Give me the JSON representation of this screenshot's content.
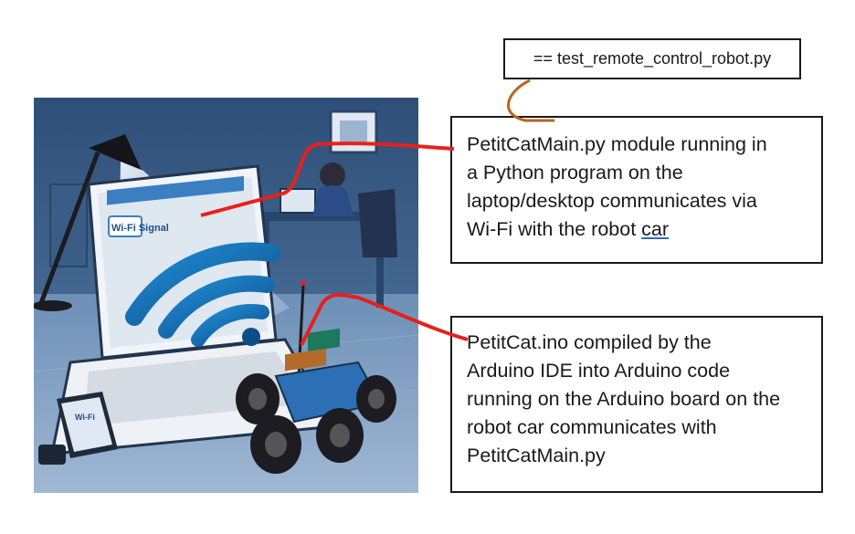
{
  "label": "== test_remote_control_robot.py",
  "box_top": {
    "line1": "PetitCatMain.py module running in",
    "line2": "a Python program on the",
    "line3": "laptop/desktop communicates via",
    "line4_prefix": "Wi-Fi with the robot ",
    "line4_underlined": "car"
  },
  "box_bottom": {
    "lines": [
      "PetitCat.ino compiled by the",
      "Arduino IDE into Arduino code",
      "running on the Arduino board on the",
      "robot car communicates with",
      "PetitCatMain.py"
    ]
  },
  "illustration": {
    "screen_label": "Wi-Fi Signal",
    "phone_label": "Wi-Fi"
  },
  "colors": {
    "connector_red": "#e8201c",
    "connector_brown": "#b8651e",
    "wifi_blue": "#1e6fb0"
  }
}
